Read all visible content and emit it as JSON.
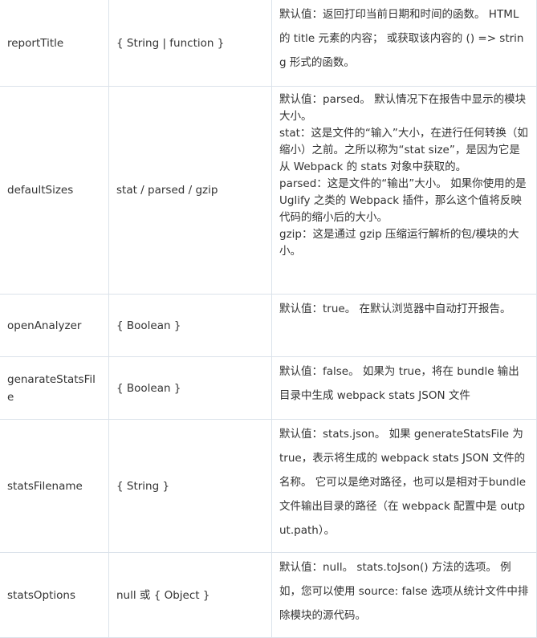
{
  "rows": [
    {
      "name": "reportTitle",
      "type": "{ String | function }",
      "desc": [
        "默认值：返回打印当前日期和时间的函数。 HTML 的 title 元素的内容； 或获取该内容的 () => string 形式的函数。"
      ]
    },
    {
      "name": "defaultSizes",
      "type": "stat / parsed / gzip",
      "desc": [
        "默认值：parsed。 默认情况下在报告中显示的模块大小。",
        "stat：这是文件的“输入”大小，在进行任何转换（如缩小）之前。之所以称为“stat size”，是因为它是从 Webpack 的 stats 对象中获取的。",
        "parsed：这是文件的“输出”大小。 如果你使用的是 Uglify 之类的 Webpack 插件，那么这个值将反映代码的缩小后的大小。",
        "gzip：这是通过 gzip 压缩运行解析的包/模块的大小。"
      ]
    },
    {
      "name": "openAnalyzer",
      "type": "{ Boolean }",
      "desc": [
        "默认值：true。 在默认浏览器中自动打开报告。"
      ]
    },
    {
      "name": "genarateStatsFile",
      "type": "{ Boolean }",
      "desc": [
        "默认值：false。 如果为 true，将在 bundle 输出目录中生成 webpack stats JSON 文件"
      ]
    },
    {
      "name": "statsFilename",
      "type": "{ String }",
      "desc": [
        "默认值：stats.json。 如果 generateStatsFile 为 true，表示将生成的 webpack stats JSON 文件的名称。 它可以是绝对路径，也可以是相对于bundle文件输出目录的路径（在 webpack 配置中是 output.path）。"
      ]
    },
    {
      "name": "statsOptions",
      "type": "null 或 { Object }",
      "desc": [
        "默认值：null。 stats.toJson() 方法的选项。 例如，您可以使用 source: false 选项从统计文件中排除模块的源代码。"
      ]
    }
  ]
}
